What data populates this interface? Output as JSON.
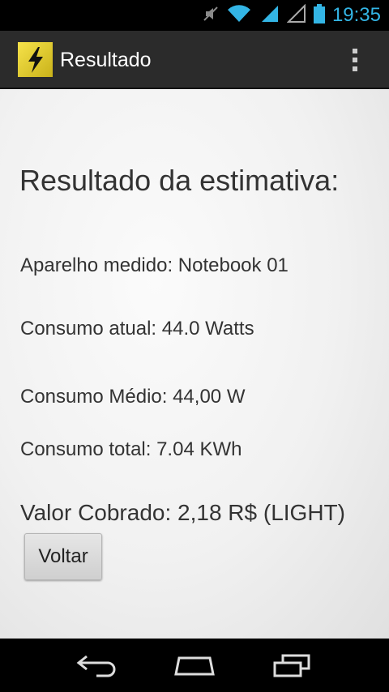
{
  "status_bar": {
    "time": "19:35",
    "icons": [
      "mute-icon",
      "wifi-icon",
      "signal-icon",
      "signal-2-icon",
      "battery-icon"
    ]
  },
  "action_bar": {
    "title": "Resultado",
    "app_icon": "lightning-icon",
    "overflow_icon": "overflow-menu-icon"
  },
  "result": {
    "heading": "Resultado da estimativa:",
    "device_line": "Aparelho medido: Notebook 01",
    "current_consumption": "Consumo atual: 44.0 Watts",
    "average_consumption": "Consumo Médio: 44,00 W",
    "total_consumption": "Consumo total: 7.04 KWh",
    "charged_value": "Valor Cobrado: 2,18 R$ (LIGHT)",
    "back_button_label": "Voltar"
  },
  "nav_bar": {
    "icons": [
      "back-icon",
      "home-icon",
      "recent-apps-icon"
    ]
  },
  "colors": {
    "status_accent": "#33b5e5",
    "action_bar_bg": "#2b2b2b",
    "app_icon_yellow": "#f6e24a"
  }
}
